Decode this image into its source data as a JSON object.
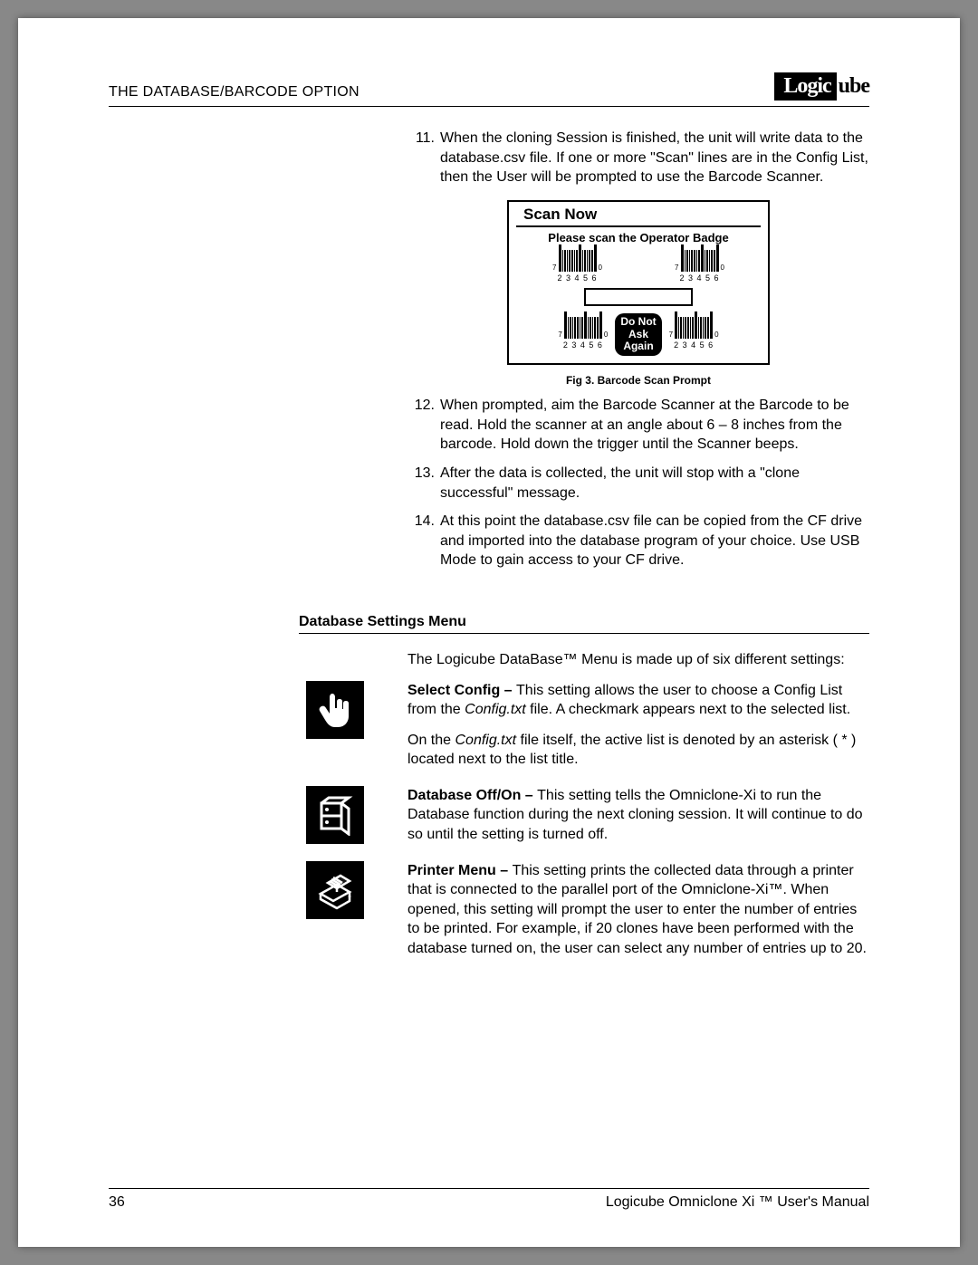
{
  "header": {
    "title": "THE DATABASE/BARCODE OPTION",
    "logo_left": "Logic",
    "logo_right": "ube"
  },
  "steps": {
    "s11_num": "11.",
    "s11": "When the cloning Session is finished, the unit will write data to the database.csv file.  If one or more \"Scan\" lines are in the Config List, then the User will be prompted to use the Barcode Scanner.",
    "s12_num": "12.",
    "s12": "When prompted, aim the Barcode Scanner at the Barcode to be read.  Hold the scanner at an angle about 6 – 8 inches from the barcode.  Hold down the trigger until the Scanner beeps.",
    "s13_num": "13.",
    "s13": "After the data is collected, the unit will stop with a \"clone successful\" message.",
    "s14_num": "14.",
    "s14": "At this point the database.csv file can be copied from the CF drive and imported into the database program of your choice.  Use USB Mode to gain access to your CF drive."
  },
  "fig": {
    "scan_title": "Scan Now",
    "scan_sub": "Please scan the Operator Badge",
    "bar_nums": "2 3 4 5 6",
    "seven": "7",
    "zero": "0",
    "do_not": "Do Not\nAsk\nAgain",
    "caption": "Fig 3.  Barcode Scan Prompt"
  },
  "section": {
    "heading": "Database Settings Menu",
    "intro": "The Logicube DataBase™ Menu is made up of six different settings:"
  },
  "settings": {
    "sel_label": "Select Config – ",
    "sel_text": "This setting allows the user to choose a Config List from the ",
    "sel_file": "Config.txt",
    "sel_text2": " file.  A checkmark appears next to the selected list.",
    "sel_para2a": "On the ",
    "sel_para2b": "Config.txt",
    "sel_para2c": " file itself, the active list is denoted by an asterisk ( * ) located next to the list title.",
    "db_label": "Database Off/On – ",
    "db_text": "This setting tells the Omniclone-Xi to run the Database function during the next cloning session.  It will continue to do so until the setting is turned off.",
    "pr_label": "Printer Menu – ",
    "pr_text": "This setting prints the collected data through a printer that is connected to the parallel port of the Omniclone-Xi™.  When opened, this setting will prompt the user to enter the number of entries to be printed.  For example, if 20 clones have been performed with the database turned on, the user can select any number of entries up to 20."
  },
  "footer": {
    "page": "36",
    "manual": "Logicube Omniclone Xi ™ User's Manual"
  }
}
